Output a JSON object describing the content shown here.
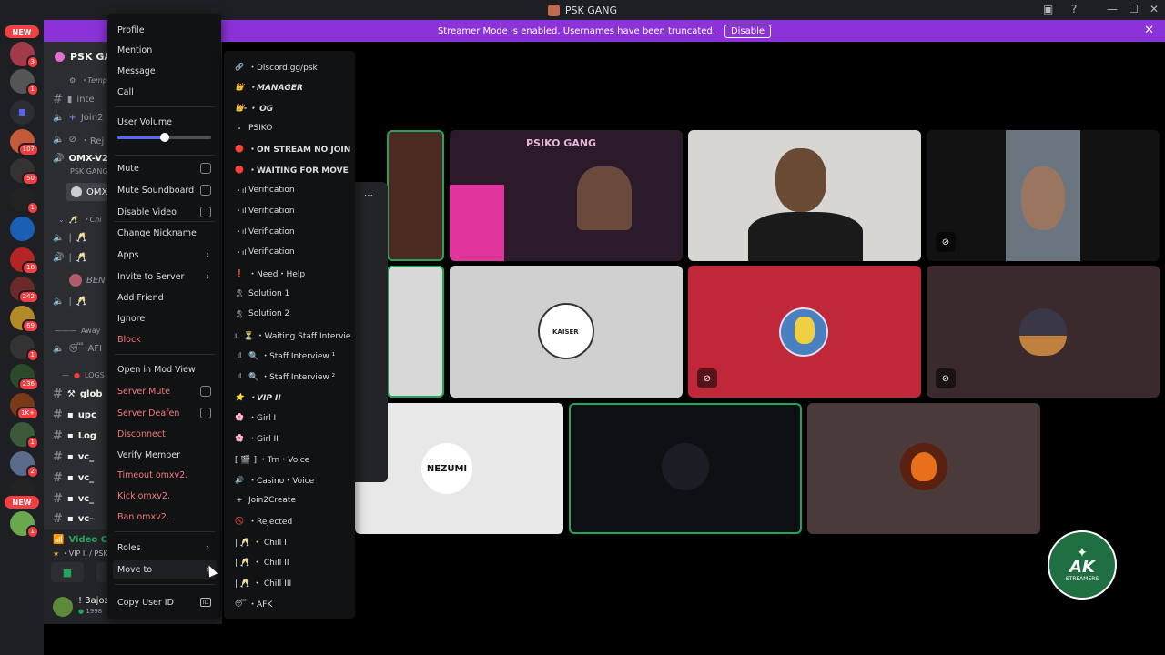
{
  "window": {
    "title": "PSK GANG",
    "controls": {
      "minimize": "—",
      "maximize": "☐",
      "close": "✕"
    }
  },
  "banner": {
    "text": "Streamer Mode is enabled. Usernames have been truncated.",
    "disable_label": "Disable"
  },
  "server_rail": {
    "badges": [
      "3",
      "1",
      "107",
      "50",
      "1",
      "18",
      "242",
      "69",
      "1",
      "236",
      "1K+",
      "1",
      "2",
      "1"
    ],
    "new_label": "NEW"
  },
  "sidebar": {
    "server_name": "PSK GAN",
    "rows": [
      {
        "text": "・Temp",
        "kind": "category"
      },
      {
        "text": "inte",
        "kind": "text"
      },
      {
        "text": "Join2",
        "kind": "voice"
      },
      {
        "text": "・Rej",
        "kind": "voice"
      },
      {
        "text": "OMX-V2",
        "kind": "voice"
      },
      {
        "text": "PSK GANG",
        "kind": "sub"
      },
      {
        "text": "OMX",
        "kind": "user"
      },
      {
        "text": "・Chi",
        "kind": "category"
      },
      {
        "text": "BEN",
        "kind": "user"
      },
      {
        "text": "Away",
        "kind": "category"
      },
      {
        "text": "AFI",
        "kind": "voice"
      },
      {
        "text": "LOGS",
        "kind": "category"
      },
      {
        "text": "glob",
        "kind": "text-bold"
      },
      {
        "text": "upc",
        "kind": "text-bold"
      },
      {
        "text": "Log",
        "kind": "text-bold"
      },
      {
        "text": "vc_",
        "kind": "text-bold"
      },
      {
        "text": "vc_",
        "kind": "text-bold"
      },
      {
        "text": "vc_",
        "kind": "text-bold"
      },
      {
        "text": "vc-",
        "kind": "text-bold"
      }
    ],
    "voice_connected": {
      "title": "Video Connected",
      "subtitle": "・VIP II / PSK GAN"
    },
    "user": {
      "name": "! 3ajoz",
      "status": "1998"
    }
  },
  "context_menu": {
    "items": [
      {
        "label": "Profile",
        "type": "item"
      },
      {
        "label": "Mention",
        "type": "item"
      },
      {
        "label": "Message",
        "type": "item"
      },
      {
        "label": "Call",
        "type": "item"
      },
      {
        "label": "User Volume",
        "type": "slider",
        "value": 0.5
      },
      {
        "label": "Mute",
        "type": "checkbox"
      },
      {
        "label": "Mute Soundboard",
        "type": "checkbox"
      },
      {
        "label": "Disable Video",
        "type": "checkbox"
      },
      {
        "label": "Change Nickname",
        "type": "item"
      },
      {
        "label": "Apps",
        "type": "submenu"
      },
      {
        "label": "Invite to Server",
        "type": "submenu"
      },
      {
        "label": "Add Friend",
        "type": "item"
      },
      {
        "label": "Ignore",
        "type": "item"
      },
      {
        "label": "Block",
        "type": "danger"
      },
      {
        "label": "Open in Mod View",
        "type": "item"
      },
      {
        "label": "Server Mute",
        "type": "danger-checkbox"
      },
      {
        "label": "Server Deafen",
        "type": "danger-checkbox"
      },
      {
        "label": "Disconnect",
        "type": "danger"
      },
      {
        "label": "Verify Member",
        "type": "item"
      },
      {
        "label": "Timeout omxv2.",
        "type": "danger"
      },
      {
        "label": "Kick omxv2.",
        "type": "danger"
      },
      {
        "label": "Ban omxv2.",
        "type": "danger"
      },
      {
        "label": "Roles",
        "type": "submenu"
      },
      {
        "label": "Move to",
        "type": "submenu"
      },
      {
        "label": "Copy User ID",
        "type": "id"
      }
    ]
  },
  "move_to_menu": {
    "items": [
      {
        "label": "・Discord.gg/psk",
        "icon": "🔗",
        "style": "normal"
      },
      {
        "label": "・MANAGER",
        "icon": "👑",
        "style": "italic"
      },
      {
        "label": "・ OG",
        "icon": "👑-",
        "style": "italic"
      },
      {
        "label": "PSIKO",
        "icon": "・",
        "style": "normal"
      },
      {
        "label": "・ON STREAM NO JOIN",
        "icon": "🔴",
        "style": "strong"
      },
      {
        "label": "・WAITING FOR MOVE",
        "icon": "🔴",
        "style": "strong"
      },
      {
        "label": "Verification",
        "icon": "・ıl",
        "style": "normal"
      },
      {
        "label": "Verification",
        "icon": "・ıl",
        "style": "normal"
      },
      {
        "label": "Verification",
        "icon": "・ıl",
        "style": "normal"
      },
      {
        "label": "Verification",
        "icon": "・ıl",
        "style": "normal"
      },
      {
        "label": "・Need・Help",
        "icon": "❗",
        "style": "normal"
      },
      {
        "label": "Solution 1",
        "icon": "🎗",
        "style": "normal"
      },
      {
        "label": "Solution 2",
        "icon": "🎗",
        "style": "normal"
      },
      {
        "label": "⏳ ・Waiting Staff Interview",
        "icon": "ıl",
        "style": "normal"
      },
      {
        "label": "🔍 ・Staff Interview ¹",
        "icon": "ıl",
        "style": "normal"
      },
      {
        "label": "🔍 ・Staff Interview ²",
        "icon": "ıl",
        "style": "normal"
      },
      {
        "label": "・VIP II",
        "icon": "⭐",
        "style": "italic"
      },
      {
        "label": "・Girl I",
        "icon": "🌸",
        "style": "normal"
      },
      {
        "label": "・Girl II",
        "icon": "🌸",
        "style": "normal"
      },
      {
        "label": "[ 🎬 ] ・Trn・Voice",
        "icon": "",
        "style": "normal"
      },
      {
        "label": "・Casino・Voice",
        "icon": "🔊",
        "style": "normal"
      },
      {
        "label": "Join2Create",
        "icon": "+",
        "style": "normal"
      },
      {
        "label": "・Rejected",
        "icon": "🚫",
        "style": "normal"
      },
      {
        "label": "| 🥂 ・ Chill I",
        "icon": "",
        "style": "normal"
      },
      {
        "label": "| 🥂 ・ Chill II",
        "icon": "",
        "style": "normal"
      },
      {
        "label": "| 🥂 ・ Chill III",
        "icon": "",
        "style": "normal"
      },
      {
        "label": "・AFK",
        "icon": "😴",
        "style": "normal"
      }
    ]
  },
  "video_tiles": {
    "psiko_sign": "PSIKO GANG",
    "nezumi_text": "NEZUMI",
    "kaiser_text": "KAISER"
  },
  "stream_logo": {
    "title": "AK",
    "subtitle": "STREAMERS"
  },
  "colors": {
    "accent": "#5865f2",
    "banner": "#8b32d9",
    "speaking": "#23a559",
    "danger": "#f27a7c",
    "red_tile": "#c0283a"
  }
}
